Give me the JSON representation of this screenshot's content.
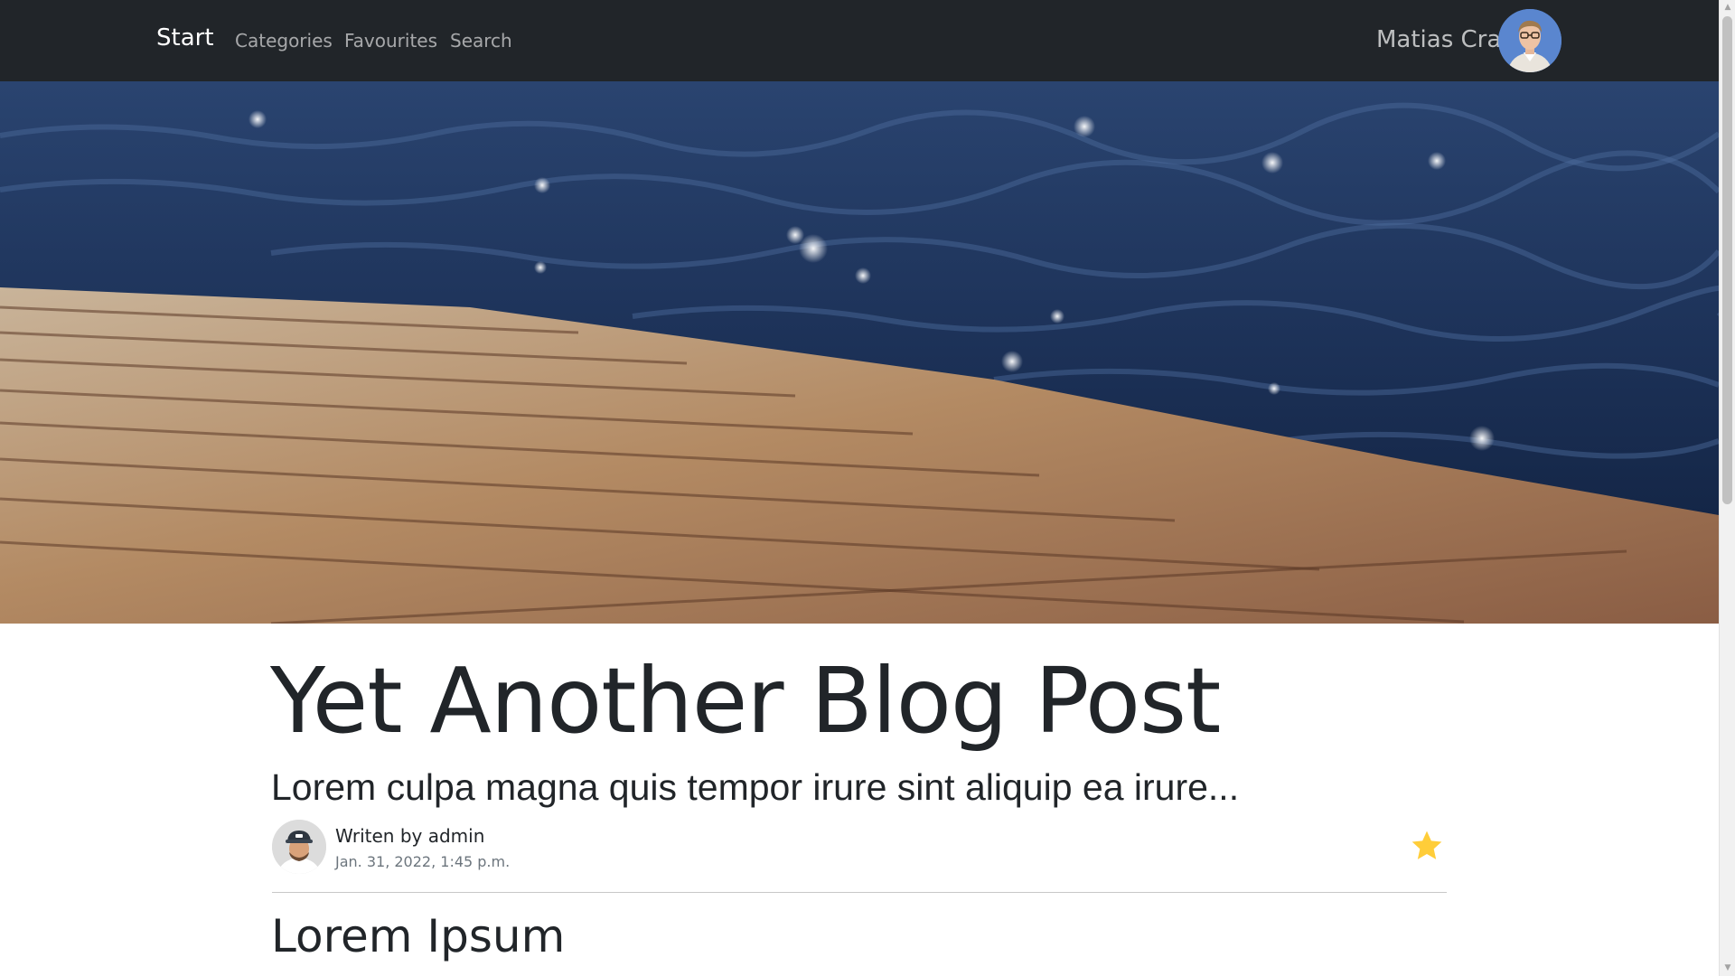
{
  "navbar": {
    "brand": "Start",
    "links": [
      {
        "label": "Categories"
      },
      {
        "label": "Favourites"
      },
      {
        "label": "Search"
      }
    ],
    "user_name": "Matias Cra"
  },
  "post": {
    "title": "Yet Another Blog Post",
    "lead": "Lorem culpa magna quis tempor irure sint aliquip ea irure...",
    "author_line": "Writen by admin",
    "date": "Jan. 31, 2022, 1:45 p.m.",
    "section_heading": "Lorem Ipsum"
  },
  "colors": {
    "navbar_bg": "#212529",
    "favourite_star": "#ffc107"
  },
  "icons": {
    "favourite": "star-icon"
  }
}
